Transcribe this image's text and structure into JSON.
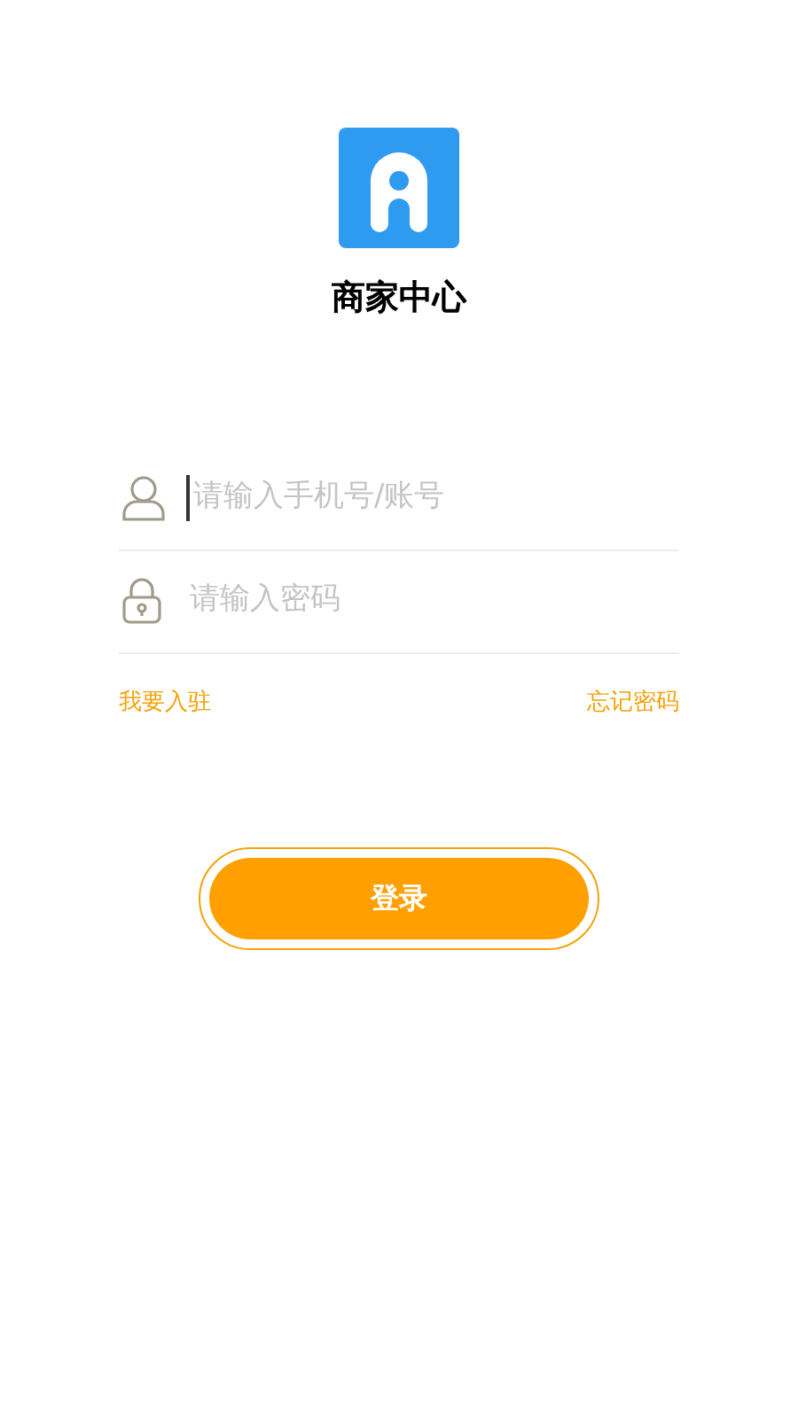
{
  "app_title": "商家中心",
  "fields": [
    {
      "kind": "user",
      "placeholder": "请输入手机号/账号",
      "focused": true
    },
    {
      "kind": "lock",
      "placeholder": "请输入密码",
      "focused": false
    }
  ],
  "links": [
    "我要入驻",
    "忘记密码"
  ],
  "login_button": "登录"
}
